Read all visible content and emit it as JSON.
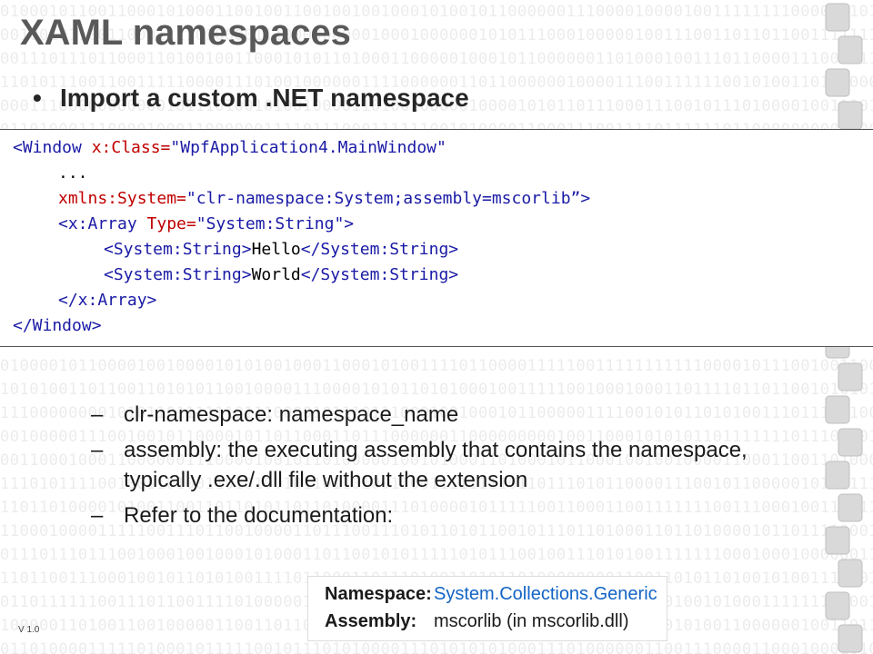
{
  "slide": {
    "title": "XAML namespaces",
    "bullet": "Import a custom .NET namespace",
    "version": "V 1.0"
  },
  "code": {
    "line1": {
      "open": "<Window ",
      "attr": "x:Class=",
      "val": "\"WpfApplication4.MainWindow\""
    },
    "line2": "...",
    "line3": {
      "attr": "xmlns:System=",
      "val": "\"clr-namespace:System;assembly=mscorlib”>"
    },
    "line4": {
      "open": "<x:Array ",
      "attr": "Type=",
      "val": "\"System:String\"",
      "close": ">"
    },
    "line5": {
      "open": "<System:String>",
      "text": "Hello",
      "close": "</System:String>"
    },
    "line6": {
      "open": "<System:String>",
      "text": "World",
      "close": "</System:String>"
    },
    "line7": "</x:Array>",
    "line8": "</Window>"
  },
  "sub_bullets": [
    {
      "dash": "–",
      "text": "clr-namespace: namespace_name"
    },
    {
      "dash": "–",
      "text": "assembly:  the executing assembly that contains the namespace, typically .exe/.dll file without the extension"
    },
    {
      "dash": "–",
      "text": "Refer to the documentation:"
    }
  ],
  "doc_panel": {
    "namespace_label": "Namespace:",
    "namespace_value": "System.Collections.Generic",
    "assembly_label": "Assembly:",
    "assembly_value": "mscorlib (in mscorlib.dll)"
  },
  "colors": {
    "title": "#595959",
    "code_tag": "#1a1aa6",
    "code_attr": "#c00000",
    "link": "#1364c4"
  }
}
